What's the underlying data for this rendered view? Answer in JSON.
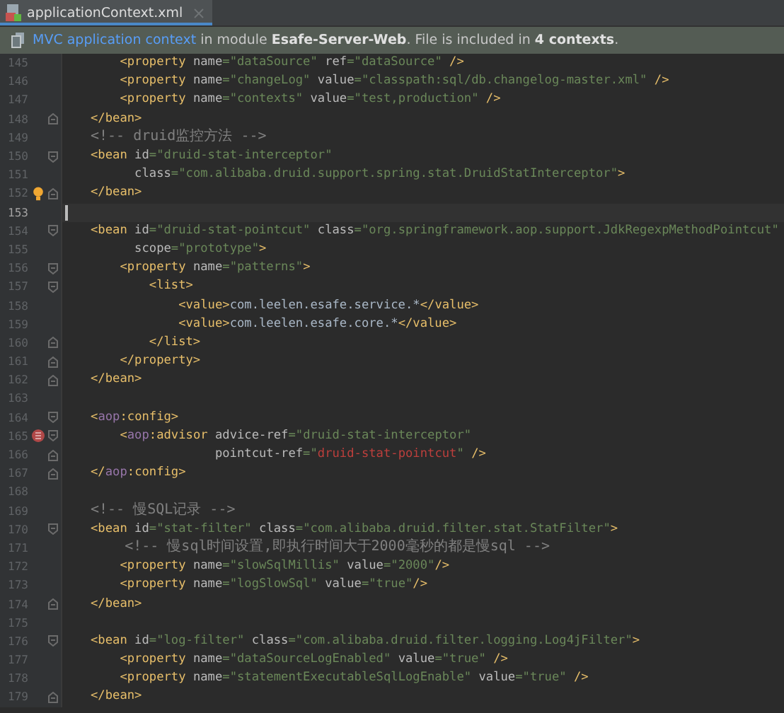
{
  "tabs": [
    {
      "label": "applicationContext.xml",
      "selected": true
    }
  ],
  "banner": {
    "link": "MVC application context",
    "text": "in module **Esafe-Server-Web**. File is included in **4 contexts**."
  },
  "lines": [
    {
      "number": "145",
      "fold_start": false,
      "fold_end": false,
      "current": false,
      "tokens": [
        {
          "kind": "tag",
          "text": "    <property"
        },
        {
          "kind": "attr",
          "text": " name"
        },
        {
          "kind": "str",
          "text": "=\"dataSource\""
        },
        {
          "kind": "attr",
          "text": " ref"
        },
        {
          "kind": "str",
          "text": "=\"dataSource\""
        },
        {
          "kind": "tag",
          "text": " />"
        }
      ]
    },
    {
      "number": "146",
      "fold_start": false,
      "fold_end": false,
      "current": false,
      "tokens": [
        {
          "kind": "tag",
          "text": "    <property"
        },
        {
          "kind": "attr",
          "text": " name"
        },
        {
          "kind": "str",
          "text": "=\"changeLog\""
        },
        {
          "kind": "attr",
          "text": " value"
        },
        {
          "kind": "str",
          "text": "=\"classpath:sql/db.changelog-master.xml\""
        },
        {
          "kind": "tag",
          "text": " />"
        }
      ]
    },
    {
      "number": "147",
      "fold_start": false,
      "fold_end": false,
      "current": false,
      "tokens": [
        {
          "kind": "tag",
          "text": "    <property"
        },
        {
          "kind": "attr",
          "text": " name"
        },
        {
          "kind": "str",
          "text": "=\"contexts\""
        },
        {
          "kind": "attr",
          "text": " value"
        },
        {
          "kind": "str",
          "text": "=\"test,production\""
        },
        {
          "kind": "tag",
          "text": " />"
        }
      ]
    },
    {
      "number": "148",
      "fold_start": false,
      "fold_end": true,
      "current": false,
      "tokens": [
        {
          "kind": "tag",
          "text": "</bean>"
        }
      ]
    },
    {
      "number": "149",
      "fold_start": false,
      "fold_end": false,
      "current": false,
      "tokens": [
        {
          "kind": "comment",
          "text": "<!-- druid监控方法 -->"
        }
      ]
    },
    {
      "number": "150",
      "fold_start": true,
      "fold_end": false,
      "current": false,
      "tokens": [
        {
          "kind": "tag",
          "text": "<bean"
        },
        {
          "kind": "attr",
          "text": " id"
        },
        {
          "kind": "str",
          "text": "=\"druid-stat-interceptor\""
        }
      ]
    },
    {
      "number": "151",
      "fold_start": false,
      "fold_end": false,
      "current": false,
      "tokens": [
        {
          "kind": "attr",
          "text": "      class"
        },
        {
          "kind": "str",
          "text": "=\"com.alibaba.druid.support.spring.stat.DruidStatInterceptor\""
        },
        {
          "kind": "tag",
          "text": ">"
        }
      ]
    },
    {
      "number": "152",
      "fold_start": false,
      "fold_end": true,
      "current": false,
      "marker": {
        "kind": "bulb"
      },
      "tokens": [
        {
          "kind": "tag",
          "text": "</bean>"
        }
      ]
    },
    {
      "number": "153",
      "fold_start": false,
      "fold_end": false,
      "current": true
    },
    {
      "number": "154",
      "fold_start": true,
      "fold_end": false,
      "current": false,
      "tokens": [
        {
          "kind": "tag",
          "text": "<bean"
        },
        {
          "kind": "attr",
          "text": " id"
        },
        {
          "kind": "str",
          "text": "=\"druid-stat-pointcut\""
        },
        {
          "kind": "attr",
          "text": " class"
        },
        {
          "kind": "str",
          "text": "=\"org.springframework.aop.support.JdkRegexpMethodPointcut\""
        }
      ]
    },
    {
      "number": "155",
      "fold_start": false,
      "fold_end": false,
      "current": false,
      "tokens": [
        {
          "kind": "attr",
          "text": "      scope"
        },
        {
          "kind": "str",
          "text": "=\"prototype\""
        },
        {
          "kind": "tag",
          "text": ">"
        }
      ]
    },
    {
      "number": "156",
      "fold_start": true,
      "fold_end": false,
      "current": false,
      "tokens": [
        {
          "kind": "tag",
          "text": "    <property"
        },
        {
          "kind": "attr",
          "text": " name"
        },
        {
          "kind": "str",
          "text": "=\"patterns\""
        },
        {
          "kind": "tag",
          "text": ">"
        }
      ]
    },
    {
      "number": "157",
      "fold_start": true,
      "fold_end": false,
      "current": false,
      "tokens": [
        {
          "kind": "tag",
          "text": "        <list>"
        }
      ]
    },
    {
      "number": "158",
      "fold_start": false,
      "fold_end": false,
      "current": false,
      "tokens": [
        {
          "kind": "tag",
          "text": "            <value>"
        },
        {
          "kind": "plain",
          "text": "com.leelen.esafe.service.*"
        },
        {
          "kind": "tag",
          "text": "</value>"
        }
      ]
    },
    {
      "number": "159",
      "fold_start": false,
      "fold_end": false,
      "current": false,
      "tokens": [
        {
          "kind": "tag",
          "text": "            <value>"
        },
        {
          "kind": "plain",
          "text": "com.leelen.esafe.core.*"
        },
        {
          "kind": "tag",
          "text": "</value>"
        }
      ]
    },
    {
      "number": "160",
      "fold_start": false,
      "fold_end": true,
      "current": false,
      "tokens": [
        {
          "kind": "tag",
          "text": "        </list>"
        }
      ]
    },
    {
      "number": "161",
      "fold_start": false,
      "fold_end": true,
      "current": false,
      "tokens": [
        {
          "kind": "tag",
          "text": "    </property>"
        }
      ]
    },
    {
      "number": "162",
      "fold_start": false,
      "fold_end": true,
      "current": false,
      "tokens": [
        {
          "kind": "tag",
          "text": "</bean>"
        }
      ]
    },
    {
      "number": "163",
      "fold_start": false,
      "fold_end": false,
      "current": false
    },
    {
      "number": "164",
      "fold_start": true,
      "fold_end": false,
      "current": false,
      "tokens": [
        {
          "kind": "tag",
          "text": "<"
        },
        {
          "kind": "ns",
          "text": "aop"
        },
        {
          "kind": "tag",
          "text": ":config>"
        }
      ]
    },
    {
      "number": "165",
      "fold_start": true,
      "fold_end": false,
      "current": false,
      "marker": {
        "kind": "bean"
      },
      "tokens": [
        {
          "kind": "tag",
          "text": "    <"
        },
        {
          "kind": "ns",
          "text": "aop"
        },
        {
          "kind": "tag",
          "text": ":advisor"
        },
        {
          "kind": "attr",
          "text": " advice-ref"
        },
        {
          "kind": "str",
          "text": "=\"druid-stat-interceptor\""
        }
      ]
    },
    {
      "number": "166",
      "fold_start": false,
      "fold_end": true,
      "current": false,
      "tokens": [
        {
          "kind": "attr",
          "text": "                 pointcut-ref"
        },
        {
          "kind": "str",
          "text": "=\""
        },
        {
          "kind": "error",
          "text": "druid-stat-pointcut"
        },
        {
          "kind": "str",
          "text": "\""
        },
        {
          "kind": "tag",
          "text": " />"
        }
      ]
    },
    {
      "number": "167",
      "fold_start": false,
      "fold_end": true,
      "current": false,
      "tokens": [
        {
          "kind": "tag",
          "text": "</"
        },
        {
          "kind": "ns",
          "text": "aop"
        },
        {
          "kind": "tag",
          "text": ":config>"
        }
      ]
    },
    {
      "number": "168",
      "fold_start": false,
      "fold_end": false,
      "current": false
    },
    {
      "number": "169",
      "fold_start": false,
      "fold_end": false,
      "current": false,
      "tokens": [
        {
          "kind": "comment",
          "text": "<!-- 慢SQL记录 -->"
        }
      ]
    },
    {
      "number": "170",
      "fold_start": true,
      "fold_end": false,
      "current": false,
      "tokens": [
        {
          "kind": "tag",
          "text": "<bean"
        },
        {
          "kind": "attr",
          "text": " id"
        },
        {
          "kind": "str",
          "text": "=\"stat-filter\""
        },
        {
          "kind": "attr",
          "text": " class"
        },
        {
          "kind": "str",
          "text": "=\"com.alibaba.druid.filter.stat.StatFilter\""
        },
        {
          "kind": "tag",
          "text": ">"
        }
      ]
    },
    {
      "number": "171",
      "fold_start": false,
      "fold_end": false,
      "current": false,
      "tokens": [
        {
          "kind": "comment",
          "text": "    <!-- 慢sql时间设置,即执行时间大于2000毫秒的都是慢sql -->"
        }
      ]
    },
    {
      "number": "172",
      "fold_start": false,
      "fold_end": false,
      "current": false,
      "tokens": [
        {
          "kind": "tag",
          "text": "    <property"
        },
        {
          "kind": "attr",
          "text": " name"
        },
        {
          "kind": "str",
          "text": "=\"slowSqlMillis\""
        },
        {
          "kind": "attr",
          "text": " value"
        },
        {
          "kind": "str",
          "text": "=\"2000\""
        },
        {
          "kind": "tag",
          "text": "/>"
        }
      ]
    },
    {
      "number": "173",
      "fold_start": false,
      "fold_end": false,
      "current": false,
      "tokens": [
        {
          "kind": "tag",
          "text": "    <property"
        },
        {
          "kind": "attr",
          "text": " name"
        },
        {
          "kind": "str",
          "text": "=\"logSlowSql\""
        },
        {
          "kind": "attr",
          "text": " value"
        },
        {
          "kind": "str",
          "text": "=\"true\""
        },
        {
          "kind": "tag",
          "text": "/>"
        }
      ]
    },
    {
      "number": "174",
      "fold_start": false,
      "fold_end": true,
      "current": false,
      "tokens": [
        {
          "kind": "tag",
          "text": "</bean>"
        }
      ]
    },
    {
      "number": "175",
      "fold_start": false,
      "fold_end": false,
      "current": false
    },
    {
      "number": "176",
      "fold_start": true,
      "fold_end": false,
      "current": false,
      "tokens": [
        {
          "kind": "tag",
          "text": "<bean"
        },
        {
          "kind": "attr",
          "text": " id"
        },
        {
          "kind": "str",
          "text": "=\"log-filter\""
        },
        {
          "kind": "attr",
          "text": " class"
        },
        {
          "kind": "str",
          "text": "=\"com.alibaba.druid.filter.logging.Log4jFilter\""
        },
        {
          "kind": "tag",
          "text": ">"
        }
      ]
    },
    {
      "number": "177",
      "fold_start": false,
      "fold_end": false,
      "current": false,
      "tokens": [
        {
          "kind": "tag",
          "text": "    <property"
        },
        {
          "kind": "attr",
          "text": " name"
        },
        {
          "kind": "str",
          "text": "=\"dataSourceLogEnabled\""
        },
        {
          "kind": "attr",
          "text": " value"
        },
        {
          "kind": "str",
          "text": "=\"true\""
        },
        {
          "kind": "tag",
          "text": " />"
        }
      ]
    },
    {
      "number": "178",
      "fold_start": false,
      "fold_end": false,
      "current": false,
      "tokens": [
        {
          "kind": "tag",
          "text": "    <property"
        },
        {
          "kind": "attr",
          "text": " name"
        },
        {
          "kind": "str",
          "text": "=\"statementExecutableSqlLogEnable\""
        },
        {
          "kind": "attr",
          "text": " value"
        },
        {
          "kind": "str",
          "text": "=\"true\""
        },
        {
          "kind": "tag",
          "text": " />"
        }
      ]
    },
    {
      "number": "179",
      "fold_start": false,
      "fold_end": true,
      "current": false,
      "tokens": [
        {
          "kind": "tag",
          "text": "</bean>"
        }
      ]
    }
  ]
}
